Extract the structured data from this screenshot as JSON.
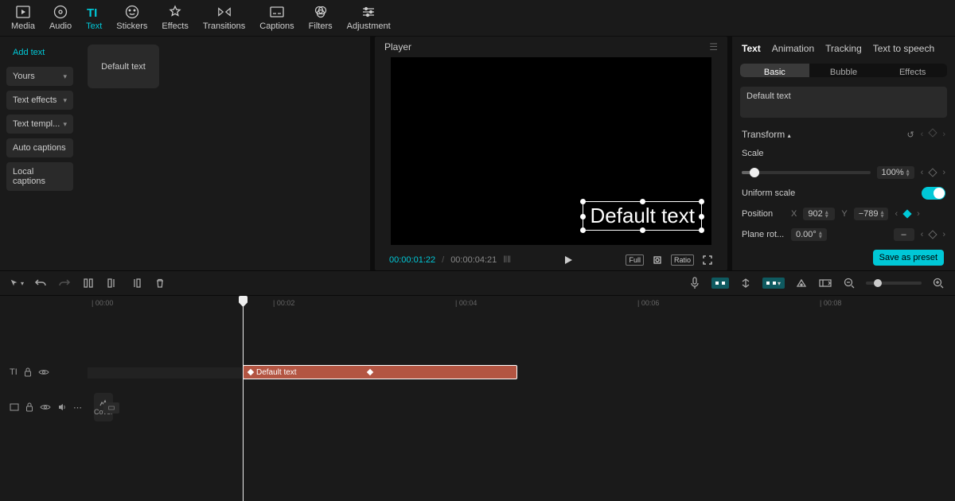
{
  "toolbar": {
    "items": [
      {
        "label": "Media"
      },
      {
        "label": "Audio"
      },
      {
        "label": "Text"
      },
      {
        "label": "Stickers"
      },
      {
        "label": "Effects"
      },
      {
        "label": "Transitions"
      },
      {
        "label": "Captions"
      },
      {
        "label": "Filters"
      },
      {
        "label": "Adjustment"
      }
    ],
    "active": "Text"
  },
  "leftPanel": {
    "addText": "Add text",
    "buttons": [
      {
        "label": "Yours",
        "chev": true
      },
      {
        "label": "Text effects",
        "chev": true
      },
      {
        "label": "Text templ...",
        "chev": true
      },
      {
        "label": "Auto captions",
        "chev": false
      },
      {
        "label": "Local captions",
        "chev": false
      }
    ],
    "thumbLabel": "Default text"
  },
  "player": {
    "title": "Player",
    "overlayText": "Default text",
    "timecodeCurrent": "00:00:01:22",
    "timecodeDuration": "00:00:04:21",
    "badges": {
      "full": "Full",
      "ratio": "Ratio"
    }
  },
  "props": {
    "tabs": [
      "Text",
      "Animation",
      "Tracking",
      "Text to speech"
    ],
    "activeTab": "Text",
    "subTabs": [
      "Basic",
      "Bubble",
      "Effects"
    ],
    "activeSub": "Basic",
    "textValue": "Default text",
    "transformLabel": "Transform",
    "scale": {
      "label": "Scale",
      "value": "100%",
      "pct": 10
    },
    "uniformScale": {
      "label": "Uniform scale",
      "on": true
    },
    "position": {
      "label": "Position",
      "xLabel": "X",
      "x": "902",
      "yLabel": "Y",
      "y": "−789"
    },
    "planeRot": {
      "label": "Plane rot...",
      "value": "0.00°",
      "dash": "–"
    },
    "presetBtn": "Save as preset"
  },
  "timeline": {
    "ruler": [
      "00:00",
      "00:02",
      "00:04",
      "00:06",
      "00:08"
    ],
    "playheadPx": 195,
    "textClip": {
      "label": "Default text",
      "leftPx": 195,
      "widthPx": 345
    },
    "coverLabel": "Cover"
  }
}
